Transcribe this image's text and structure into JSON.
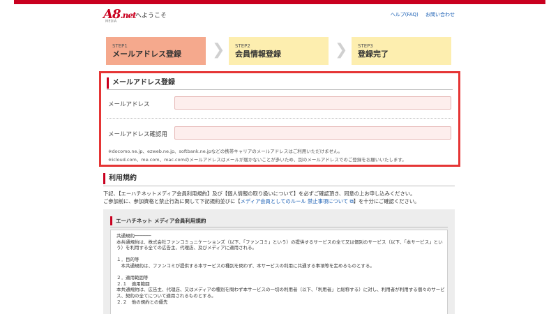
{
  "header": {
    "logo_main": "A8",
    "logo_suffix": ".net",
    "logo_sub": "MEDIA",
    "welcome": "へようこそ",
    "links": [
      "ヘルプ(FAQ)",
      "お問い合わせ"
    ]
  },
  "steps": [
    {
      "num": "STEP1",
      "title": "メールアドレス登録"
    },
    {
      "num": "STEP2",
      "title": "会員情報登録"
    },
    {
      "num": "STEP3",
      "title": "登録完了"
    }
  ],
  "form": {
    "title": "メールアドレス登録",
    "email_label": "メールアドレス",
    "email_value": "",
    "confirm_label": "メールアドレス確認用",
    "confirm_value": "",
    "notes": [
      "※docomo.ne.jp、ezweb.ne.jp、softbank.ne.jpなどの携帯キャリアのメールアドレスはご利用いただけません。",
      "※icloud.com、me.com、mac.comのメールアドレスはメールが届かないことが多いため、別のメールアドレスでのご登録をお願いいたします。"
    ]
  },
  "terms": {
    "title": "利用規約",
    "intro_line1": "下記、【エーハチネットメディア会員利用規約】及び【個人情報の取り扱いについて】を必ずご確認頂き、同意の上お申し込みください。",
    "intro_line2_pre": "ご参加前に、参加資格と禁止行為に関して下記規約並びに【",
    "intro_link": "メディア会員としてのルール 禁止事項について ⧉",
    "intro_line2_post": "】を十分にご確認ください。",
    "panel_title": "エーハチネット メディア会員利用規約",
    "doc_lines": [
      "共通規約──────",
      "本共通規約は、株式会社ファンコミュニケーションズ（以下、「ファンコミ」という）の提供するサービスの全て又は個別のサービス（以下、「本サービス」とい",
      "う）を利用する全ての広告主、代理店、及びメディアに適用される。",
      "",
      "１．目的等",
      "　本共通規約は、ファンコミが提供する本サービスの種別を問わず、本サービスの利用に共通する事項等を定めるものとする。",
      "",
      "２．適用範囲等",
      "２.１　適用範囲",
      "本共通規約は、広告主、代理店、又はメディアの種別を問わず本サービスの一切の利用者（以下、「利用者」と総称する）に対し、利用者が利用する個々のサービ",
      "ス、契約の全てについて適用されるものとする。",
      "２.２　他の規約との優先"
    ]
  },
  "colors": {
    "brand": "#c9001f",
    "step_active": "#f5a98d",
    "step_inactive": "#fdeeaf",
    "highlight_border": "#e53535",
    "input_bg": "#fdeeed",
    "link": "#1a5fb4"
  }
}
